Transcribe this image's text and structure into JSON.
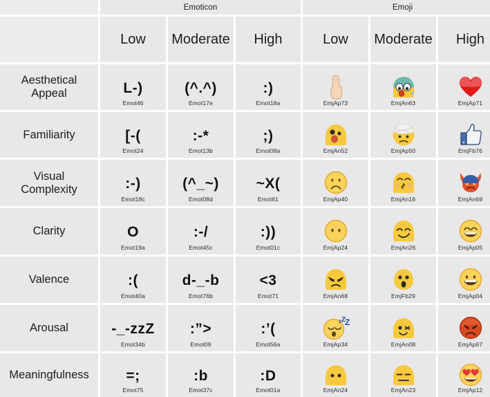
{
  "table": {
    "group_headers": [
      {
        "label": "",
        "name": "corner-blank"
      },
      {
        "label": "Emoticon",
        "name": "group-header-emoticon"
      },
      {
        "label": "Emoji",
        "name": "group-header-emoji"
      }
    ],
    "level_headers": [
      "",
      "Low",
      "Moderate",
      "High",
      "Low",
      "Moderate",
      "High"
    ],
    "rows": [
      {
        "label": "Aesthetical Appeal",
        "emoticons": [
          {
            "glyph": "L-)",
            "code": "Emot46"
          },
          {
            "glyph": "(^.^)",
            "code": "Emot17e"
          },
          {
            "glyph": ":)",
            "code": "Emot18a"
          }
        ],
        "emojis": [
          {
            "icon": "pointing-hand",
            "code": "EmjAp73"
          },
          {
            "icon": "nauseated-face",
            "code": "EmjAn63"
          },
          {
            "icon": "red-heart",
            "code": "EmjAp71"
          }
        ]
      },
      {
        "label": "Familiarity",
        "emoticons": [
          {
            "glyph": "[-(",
            "code": "Emot24"
          },
          {
            "glyph": ":-*",
            "code": "Emot13b"
          },
          {
            "glyph": ";)",
            "code": "Emot08a"
          }
        ],
        "emojis": [
          {
            "icon": "shocked-blob-face",
            "code": "EmjAn52"
          },
          {
            "icon": "head-bandage-face",
            "code": "EmjAp50"
          },
          {
            "icon": "thumbs-up",
            "code": "EmjFb76"
          }
        ]
      },
      {
        "label": "Visual Complexity",
        "emoticons": [
          {
            "glyph": ":-)",
            "code": "Emot18c"
          },
          {
            "glyph": "(^_~)",
            "code": "Emot08d"
          },
          {
            "glyph": "~X(",
            "code": "Emot61"
          }
        ],
        "emojis": [
          {
            "icon": "frowning-face",
            "code": "EmjAp40"
          },
          {
            "icon": "kissing-blob-face",
            "code": "EmjAn16"
          },
          {
            "icon": "devil-face",
            "code": "EmjAn69"
          }
        ]
      },
      {
        "label": "Clarity",
        "emoticons": [
          {
            "glyph": "O",
            "code": "Emot19a"
          },
          {
            "glyph": ":-/",
            "code": "Emot45c"
          },
          {
            "glyph": ":))",
            "code": "Emot01c"
          }
        ],
        "emojis": [
          {
            "icon": "no-mouth-face",
            "code": "EmjAp24"
          },
          {
            "icon": "smirking-blob-face",
            "code": "EmjAn26"
          },
          {
            "icon": "grinning-squint-face",
            "code": "EmjAp05"
          }
        ]
      },
      {
        "label": "Valence",
        "emoticons": [
          {
            "glyph": ":(",
            "code": "Emot40a"
          },
          {
            "glyph": "d-_-b",
            "code": "Emot76b"
          },
          {
            "glyph": "<3",
            "code": "Emot71"
          }
        ],
        "emojis": [
          {
            "icon": "angry-blob-face",
            "code": "EmjAn68"
          },
          {
            "icon": "astonished-face",
            "code": "EmjFb29"
          },
          {
            "icon": "grinning-face",
            "code": "EmjAp04"
          }
        ]
      },
      {
        "label": "Arousal",
        "emoticons": [
          {
            "glyph": "-_-zzZ",
            "code": "Emot34b"
          },
          {
            "glyph": ":”>",
            "code": "Emot09"
          },
          {
            "glyph": ":’(",
            "code": "Emot56a"
          }
        ],
        "emojis": [
          {
            "icon": "sleeping-face",
            "code": "EmjAp34"
          },
          {
            "icon": "winking-blob-face",
            "code": "EmjAn08"
          },
          {
            "icon": "pouting-red-face",
            "code": "EmjAp67"
          }
        ]
      },
      {
        "label": "Meaningfulness",
        "emoticons": [
          {
            "glyph": "=;",
            "code": "Emot75"
          },
          {
            "glyph": ":b",
            "code": "Emot37c"
          },
          {
            "glyph": ":D",
            "code": "Emot01a"
          }
        ],
        "emojis": [
          {
            "icon": "neutral-blob-face",
            "code": "EmjAn24"
          },
          {
            "icon": "expressionless-blob-face",
            "code": "EmjAn23"
          },
          {
            "icon": "heart-eyes-face",
            "code": "EmjAp12"
          }
        ]
      }
    ],
    "colors": {
      "cell_background": "#e8e8e8",
      "page_background": "#ffffff",
      "text": "#1d1d1d",
      "emoji_yellow": "#f6c63c",
      "heart_red": "#e02020",
      "facebook_blue": "#3b5998"
    }
  }
}
